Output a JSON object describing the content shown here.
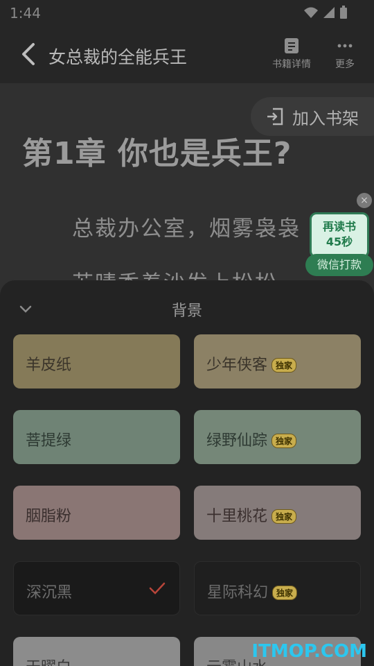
{
  "status_bar": {
    "time": "1:44"
  },
  "top_bar": {
    "title": "女总裁的全能兵王",
    "actions": [
      {
        "label": "书籍详情",
        "icon": "book-details-icon"
      },
      {
        "label": "更多",
        "icon": "more-dots-icon"
      }
    ]
  },
  "reader": {
    "add_to_shelf": "加入书架",
    "chapter_title": "第1章 你也是兵王?",
    "lines": [
      "总裁办公室，烟雾袅袅",
      "苏晴香着沙发上松松"
    ]
  },
  "promo": {
    "line1": "再读书",
    "line2": "45秒",
    "button": "微信打款",
    "close": "×"
  },
  "sheet": {
    "title": "背景",
    "backgrounds": [
      {
        "label": "羊皮纸",
        "exclusive": false,
        "selected": false,
        "color": "#857a58",
        "text_color": "#3a342a"
      },
      {
        "label": "少年侠客",
        "exclusive": true,
        "selected": false,
        "color": "#8c8165",
        "text_color": "#3a342a"
      },
      {
        "label": "菩提绿",
        "exclusive": false,
        "selected": false,
        "color": "#6f8375",
        "text_color": "#2e3a33"
      },
      {
        "label": "绿野仙踪",
        "exclusive": true,
        "selected": false,
        "color": "#758778",
        "text_color": "#2e3a33"
      },
      {
        "label": "胭脂粉",
        "exclusive": false,
        "selected": false,
        "color": "#8a7674",
        "text_color": "#3a2f2e"
      },
      {
        "label": "十里桃花",
        "exclusive": true,
        "selected": false,
        "color": "#857b7a",
        "text_color": "#3a2f2e"
      },
      {
        "label": "深沉黑",
        "exclusive": false,
        "selected": true,
        "color": "#1a1a1a",
        "text_color": "#6e6e6e"
      },
      {
        "label": "星际科幻",
        "exclusive": true,
        "selected": false,
        "color": "#1f1f1f",
        "text_color": "#6e6e6e"
      },
      {
        "label": "天曜白",
        "exclusive": false,
        "selected": false,
        "color": "#8c8c8c",
        "text_color": "#3a3a3a"
      },
      {
        "label": "云雾山水",
        "exclusive": false,
        "selected": false,
        "color": "#888888",
        "text_color": "#3a3a3a"
      }
    ],
    "exclusive_badge": "独家"
  },
  "watermark": "ITMOP.COM"
}
